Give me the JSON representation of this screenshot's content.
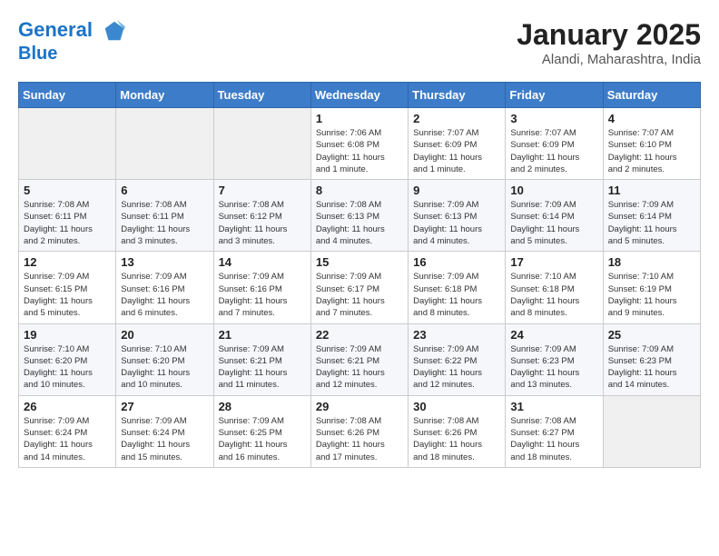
{
  "header": {
    "logo_line1": "General",
    "logo_line2": "Blue",
    "month": "January 2025",
    "location": "Alandi, Maharashtra, India"
  },
  "weekdays": [
    "Sunday",
    "Monday",
    "Tuesday",
    "Wednesday",
    "Thursday",
    "Friday",
    "Saturday"
  ],
  "weeks": [
    [
      {
        "day": "",
        "info": ""
      },
      {
        "day": "",
        "info": ""
      },
      {
        "day": "",
        "info": ""
      },
      {
        "day": "1",
        "info": "Sunrise: 7:06 AM\nSunset: 6:08 PM\nDaylight: 11 hours\nand 1 minute."
      },
      {
        "day": "2",
        "info": "Sunrise: 7:07 AM\nSunset: 6:09 PM\nDaylight: 11 hours\nand 1 minute."
      },
      {
        "day": "3",
        "info": "Sunrise: 7:07 AM\nSunset: 6:09 PM\nDaylight: 11 hours\nand 2 minutes."
      },
      {
        "day": "4",
        "info": "Sunrise: 7:07 AM\nSunset: 6:10 PM\nDaylight: 11 hours\nand 2 minutes."
      }
    ],
    [
      {
        "day": "5",
        "info": "Sunrise: 7:08 AM\nSunset: 6:11 PM\nDaylight: 11 hours\nand 2 minutes."
      },
      {
        "day": "6",
        "info": "Sunrise: 7:08 AM\nSunset: 6:11 PM\nDaylight: 11 hours\nand 3 minutes."
      },
      {
        "day": "7",
        "info": "Sunrise: 7:08 AM\nSunset: 6:12 PM\nDaylight: 11 hours\nand 3 minutes."
      },
      {
        "day": "8",
        "info": "Sunrise: 7:08 AM\nSunset: 6:13 PM\nDaylight: 11 hours\nand 4 minutes."
      },
      {
        "day": "9",
        "info": "Sunrise: 7:09 AM\nSunset: 6:13 PM\nDaylight: 11 hours\nand 4 minutes."
      },
      {
        "day": "10",
        "info": "Sunrise: 7:09 AM\nSunset: 6:14 PM\nDaylight: 11 hours\nand 5 minutes."
      },
      {
        "day": "11",
        "info": "Sunrise: 7:09 AM\nSunset: 6:14 PM\nDaylight: 11 hours\nand 5 minutes."
      }
    ],
    [
      {
        "day": "12",
        "info": "Sunrise: 7:09 AM\nSunset: 6:15 PM\nDaylight: 11 hours\nand 5 minutes."
      },
      {
        "day": "13",
        "info": "Sunrise: 7:09 AM\nSunset: 6:16 PM\nDaylight: 11 hours\nand 6 minutes."
      },
      {
        "day": "14",
        "info": "Sunrise: 7:09 AM\nSunset: 6:16 PM\nDaylight: 11 hours\nand 7 minutes."
      },
      {
        "day": "15",
        "info": "Sunrise: 7:09 AM\nSunset: 6:17 PM\nDaylight: 11 hours\nand 7 minutes."
      },
      {
        "day": "16",
        "info": "Sunrise: 7:09 AM\nSunset: 6:18 PM\nDaylight: 11 hours\nand 8 minutes."
      },
      {
        "day": "17",
        "info": "Sunrise: 7:10 AM\nSunset: 6:18 PM\nDaylight: 11 hours\nand 8 minutes."
      },
      {
        "day": "18",
        "info": "Sunrise: 7:10 AM\nSunset: 6:19 PM\nDaylight: 11 hours\nand 9 minutes."
      }
    ],
    [
      {
        "day": "19",
        "info": "Sunrise: 7:10 AM\nSunset: 6:20 PM\nDaylight: 11 hours\nand 10 minutes."
      },
      {
        "day": "20",
        "info": "Sunrise: 7:10 AM\nSunset: 6:20 PM\nDaylight: 11 hours\nand 10 minutes."
      },
      {
        "day": "21",
        "info": "Sunrise: 7:09 AM\nSunset: 6:21 PM\nDaylight: 11 hours\nand 11 minutes."
      },
      {
        "day": "22",
        "info": "Sunrise: 7:09 AM\nSunset: 6:21 PM\nDaylight: 11 hours\nand 12 minutes."
      },
      {
        "day": "23",
        "info": "Sunrise: 7:09 AM\nSunset: 6:22 PM\nDaylight: 11 hours\nand 12 minutes."
      },
      {
        "day": "24",
        "info": "Sunrise: 7:09 AM\nSunset: 6:23 PM\nDaylight: 11 hours\nand 13 minutes."
      },
      {
        "day": "25",
        "info": "Sunrise: 7:09 AM\nSunset: 6:23 PM\nDaylight: 11 hours\nand 14 minutes."
      }
    ],
    [
      {
        "day": "26",
        "info": "Sunrise: 7:09 AM\nSunset: 6:24 PM\nDaylight: 11 hours\nand 14 minutes."
      },
      {
        "day": "27",
        "info": "Sunrise: 7:09 AM\nSunset: 6:24 PM\nDaylight: 11 hours\nand 15 minutes."
      },
      {
        "day": "28",
        "info": "Sunrise: 7:09 AM\nSunset: 6:25 PM\nDaylight: 11 hours\nand 16 minutes."
      },
      {
        "day": "29",
        "info": "Sunrise: 7:08 AM\nSunset: 6:26 PM\nDaylight: 11 hours\nand 17 minutes."
      },
      {
        "day": "30",
        "info": "Sunrise: 7:08 AM\nSunset: 6:26 PM\nDaylight: 11 hours\nand 18 minutes."
      },
      {
        "day": "31",
        "info": "Sunrise: 7:08 AM\nSunset: 6:27 PM\nDaylight: 11 hours\nand 18 minutes."
      },
      {
        "day": "",
        "info": ""
      }
    ]
  ]
}
